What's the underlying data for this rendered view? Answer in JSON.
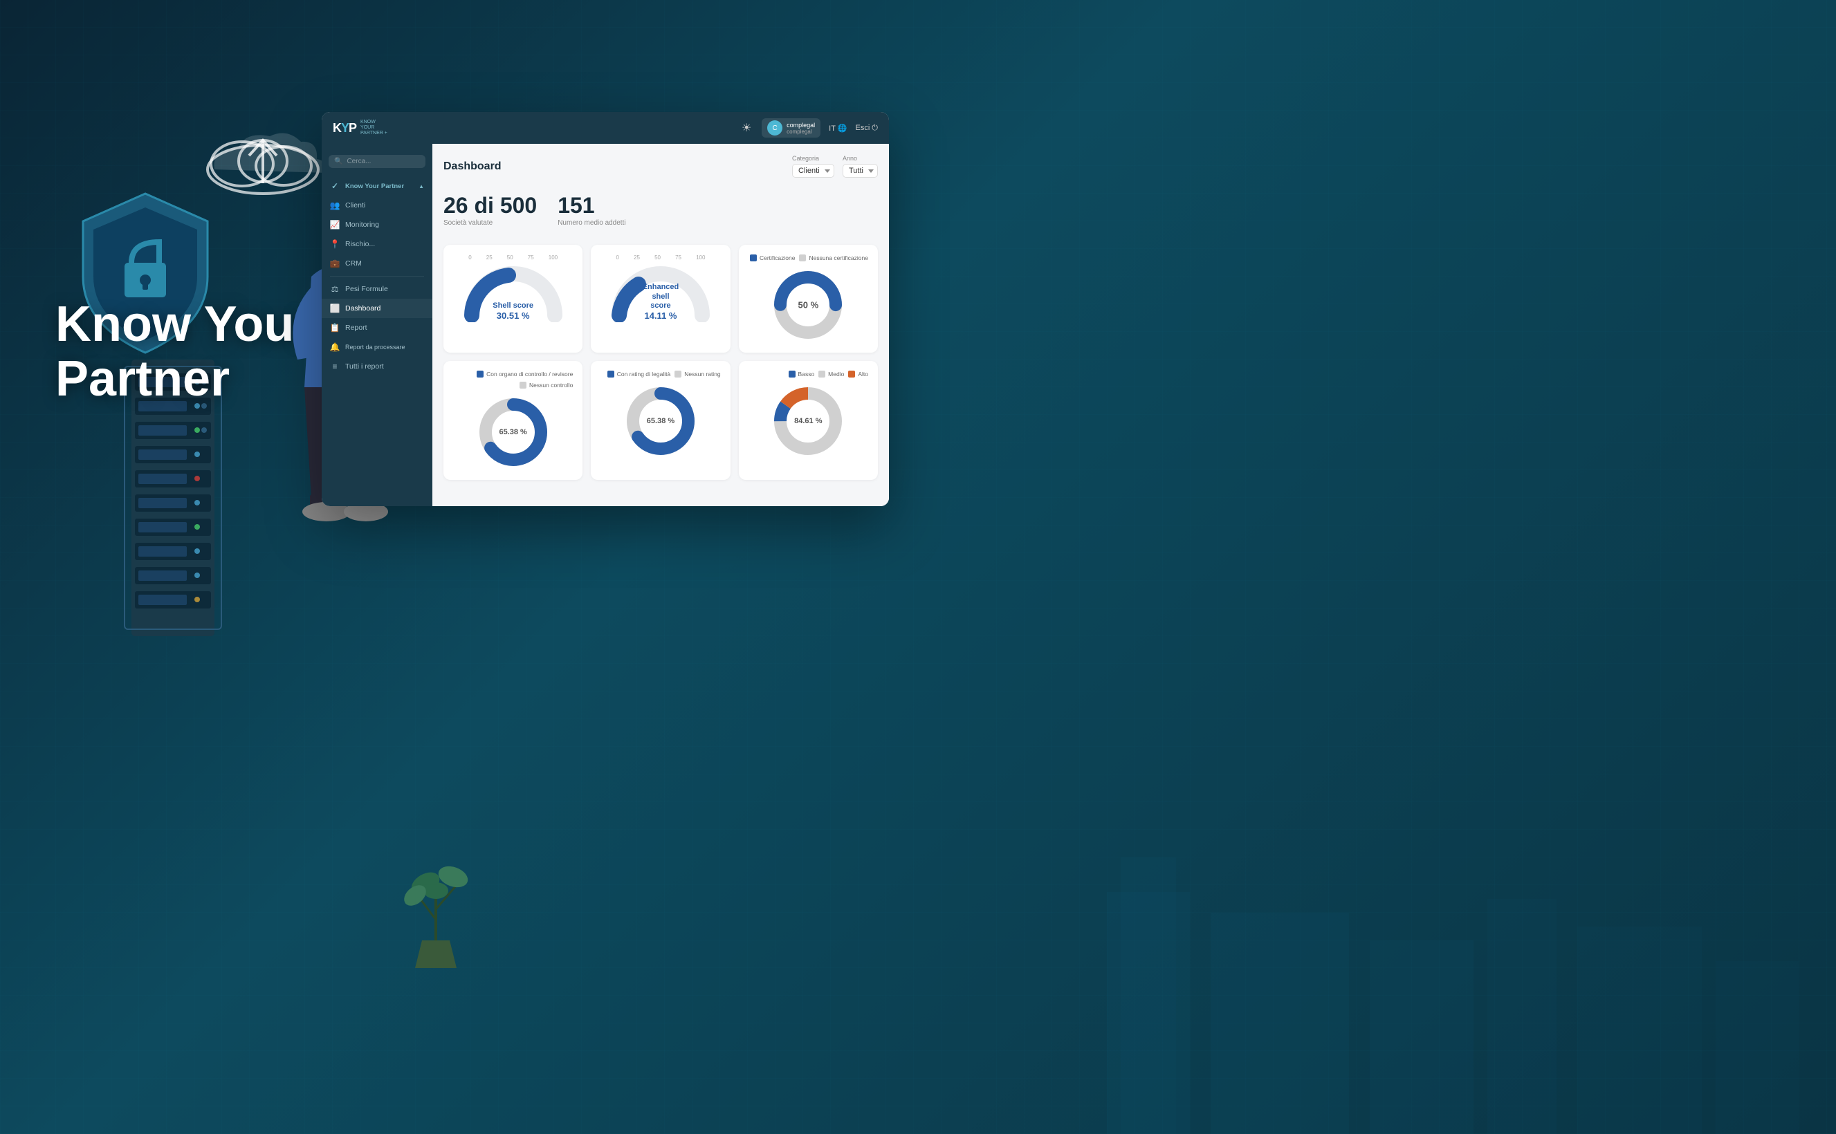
{
  "hero": {
    "title_line1": "Know Your",
    "title_line2": "Partner"
  },
  "app": {
    "logo": {
      "text": "KYP",
      "subtitle_line1": "KNOW",
      "subtitle_line2": "YOUR",
      "subtitle_line3": "PARTNER +"
    },
    "header": {
      "theme_icon": "☀",
      "user_icon": "👤",
      "user_name": "complegal",
      "user_company": "complegal",
      "lang": "IT",
      "globe_icon": "🌐",
      "exit_label": "Esci",
      "exit_icon": "⏻"
    },
    "sidebar": {
      "search_placeholder": "Cerca...",
      "items": [
        {
          "label": "Know Your Partner",
          "icon": "✓",
          "type": "parent",
          "expanded": true
        },
        {
          "label": "Clienti",
          "icon": "👥",
          "type": "child"
        },
        {
          "label": "Monitoring",
          "icon": "📈",
          "type": "child"
        },
        {
          "label": "Rischio...",
          "icon": "📍",
          "type": "child"
        },
        {
          "label": "CRM",
          "icon": "💼",
          "type": "child"
        },
        {
          "label": "Pesi Formule",
          "icon": "⚖",
          "type": "child"
        },
        {
          "label": "Dashboard",
          "icon": "⬜",
          "type": "child",
          "active": true
        },
        {
          "label": "Report",
          "icon": "📋",
          "type": "child"
        },
        {
          "label": "Report da processare",
          "icon": "🔔",
          "type": "child"
        },
        {
          "label": "Tutti i report",
          "icon": "≡",
          "type": "child"
        }
      ]
    },
    "dashboard": {
      "title": "Dashboard",
      "filters": {
        "categoria_label": "Categoria",
        "categoria_value": "Clienti",
        "anno_label": "Anno",
        "anno_value": "Tutti"
      },
      "stats": [
        {
          "value": "26 di 500",
          "label": "Società valutate"
        },
        {
          "value": "151",
          "label": "Numero medio addetti"
        }
      ],
      "charts_row1": [
        {
          "type": "gauge",
          "label": "Shell score",
          "value": "30.51 %",
          "percentage": 30.51,
          "color": "#2a5fa8",
          "scale_labels": [
            "0",
            "25",
            "50",
            "75",
            "100"
          ],
          "legend": []
        },
        {
          "type": "gauge",
          "label": "Enhanced shell score",
          "value": "14.11 %",
          "percentage": 14.11,
          "color": "#2a5fa8",
          "scale_labels": [
            "0",
            "25",
            "50",
            "75",
            "100"
          ],
          "legend": []
        },
        {
          "type": "donut",
          "label": "",
          "value": "50 %",
          "percentage": 50,
          "color": "#2a5fa8",
          "bg_color": "#d0d0d0",
          "legend": [
            {
              "label": "Certificazione",
              "color": "#2a5fa8"
            },
            {
              "label": "Nessuna certificazione",
              "color": "#d0d0d0"
            }
          ]
        }
      ],
      "charts_row2": [
        {
          "type": "donut",
          "value": "65.38 %",
          "percentage": 65.38,
          "color": "#2a5fa8",
          "bg_color": "#d0d0d0",
          "legend": [
            {
              "label": "Con organo di controllo / revisore",
              "color": "#2a5fa8"
            },
            {
              "label": "Nessun controllo",
              "color": "#d0d0d0"
            }
          ]
        },
        {
          "type": "donut",
          "value": "65.38 %",
          "percentage": 65.38,
          "color": "#2a5fa8",
          "bg_color": "#d0d0d0",
          "legend": [
            {
              "label": "Con rating di legalità",
              "color": "#2a5fa8"
            },
            {
              "label": "Nessun rating",
              "color": "#d0d0d0"
            }
          ]
        },
        {
          "type": "donut_multi",
          "value": "84.61 %",
          "percentages": [
            {
              "label": "Basso",
              "value": 10,
              "color": "#2a5fa8"
            },
            {
              "label": "Medio",
              "value": 75,
              "color": "#d0d0d0"
            },
            {
              "label": "Alto",
              "value": 15,
              "color": "#d4632a"
            }
          ],
          "legend": [
            {
              "label": "Basso",
              "color": "#2a5fa8"
            },
            {
              "label": "Medio",
              "color": "#d0d0d0"
            },
            {
              "label": "Alto",
              "color": "#d4632a"
            }
          ]
        }
      ]
    }
  }
}
